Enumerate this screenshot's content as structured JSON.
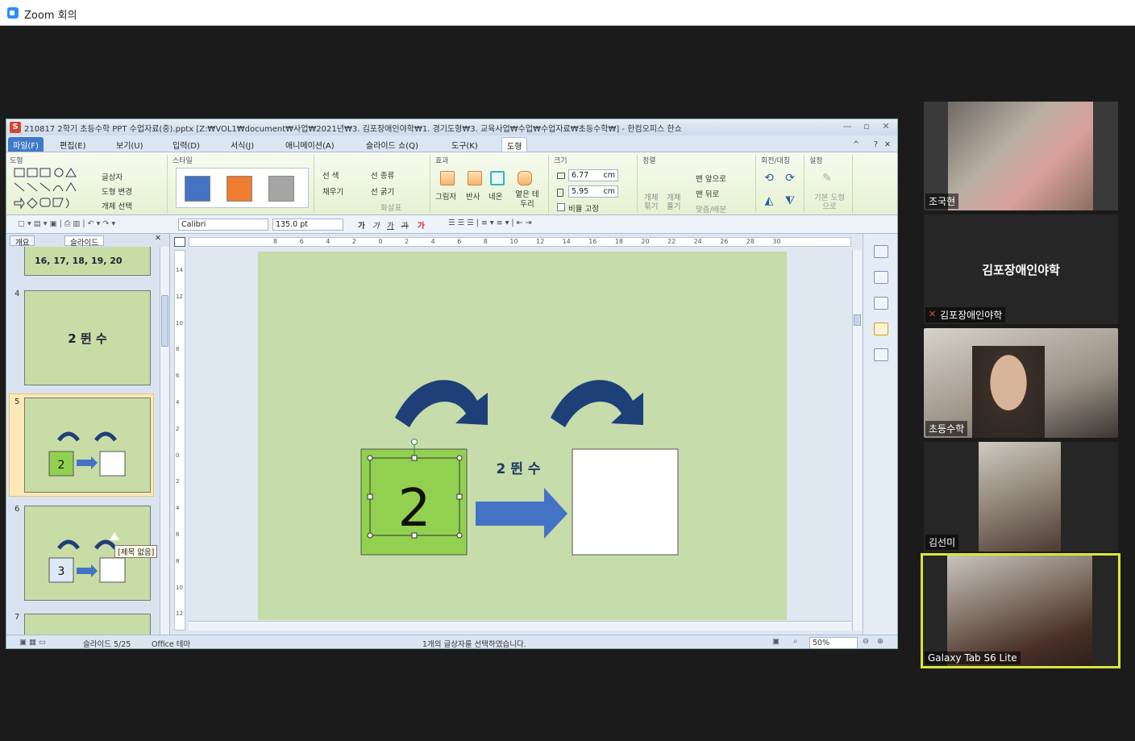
{
  "zoom": {
    "title": "Zoom 회의"
  },
  "app": {
    "title": "210817 2학기 초등수학 PPT 수업자료(중).pptx [Z:₩VOL1₩document₩사업₩2021년₩3. 김포장애인야학₩1. 경기도형₩3. 교육사업₩수업₩수업자료₩초등수학₩] - 한컴오피스 한쇼",
    "app_icon": "S",
    "window_controls": [
      "—",
      "▫",
      "✕"
    ],
    "menu": [
      "파일(F)",
      "편집(E)",
      "보기(U)",
      "입력(D)",
      "서식(J)",
      "애니메이션(A)",
      "슬라이드 쇼(Q)",
      "도구(K)",
      "도형"
    ],
    "menu_right": [
      "^",
      "?",
      "✕"
    ]
  },
  "ribbon": {
    "groups": {
      "shape": "도형",
      "style": "스타일",
      "effect": "효과",
      "size": "크기",
      "arrange": "정렬",
      "rotate": "회전/대칭",
      "setting": "설정"
    },
    "textbox": "글상자",
    "shape_change": "도형 변경",
    "object_select": "개체 선택",
    "line_color": "선 색",
    "fill": "채우기",
    "line_type": "선 종류",
    "line_width": "선 굵기",
    "arrow_style": "화살표",
    "effects": [
      "그림자",
      "반사",
      "네온",
      "옅은 테두리"
    ],
    "width": "6.77",
    "height": "5.95",
    "unit": "cm",
    "ratio_lock": "비율 고정",
    "group_obj": "개체 묶기",
    "ungroup_obj": "개체 풀기",
    "bring_front": "맨 앞으로",
    "send_back": "맨 뒤로",
    "align": "맞춤/배분",
    "default_shape": "기본 도형으로",
    "style_colors": [
      "#4472c4",
      "#ed7d31",
      "#a5a5a5"
    ]
  },
  "format": {
    "font": "Calibri",
    "size": "135.0",
    "size_unit": "pt",
    "style_buttons": [
      "가",
      "가",
      "가",
      "가",
      "가"
    ]
  },
  "slides_panel": {
    "tabs": [
      "개요",
      "슬라이드"
    ],
    "slide3_text": "16,  17,  18,  19,  20",
    "slide4": {
      "num": "4",
      "text": "2 뛴 수"
    },
    "slide5": {
      "num": "5",
      "value": "2"
    },
    "slide6": {
      "num": "6",
      "value": "3"
    },
    "slide7": {
      "num": "7"
    },
    "tooltip": "[제목 없음]"
  },
  "ruler": {
    "h": [
      "8",
      "6",
      "4",
      "2",
      "0",
      "2",
      "4",
      "6",
      "8",
      "10",
      "12",
      "14",
      "16",
      "18",
      "20",
      "22",
      "24",
      "26",
      "28",
      "30"
    ],
    "v": [
      "14",
      "12",
      "10",
      "8",
      "6",
      "4",
      "2",
      "0",
      "2",
      "4",
      "6",
      "8",
      "10",
      "12"
    ]
  },
  "slide": {
    "value": "2",
    "label": "2 뛴 수",
    "colors": {
      "box": "#92d050",
      "arrow": "#4472c4",
      "curve": "#1f3f78",
      "bg": "#c6dcab"
    }
  },
  "status": {
    "slide": "슬라이드 5/25",
    "theme": "Office 테마",
    "message": "1개의 글상자를 선택하였습니다.",
    "zoom": "50%"
  },
  "participants": [
    {
      "name": "조국현"
    },
    {
      "name": "김포장애인야학",
      "muted": true
    },
    {
      "name": "초등수학"
    },
    {
      "name": "김선미"
    },
    {
      "name": "Galaxy Tab S6 Lite",
      "active": true
    }
  ]
}
